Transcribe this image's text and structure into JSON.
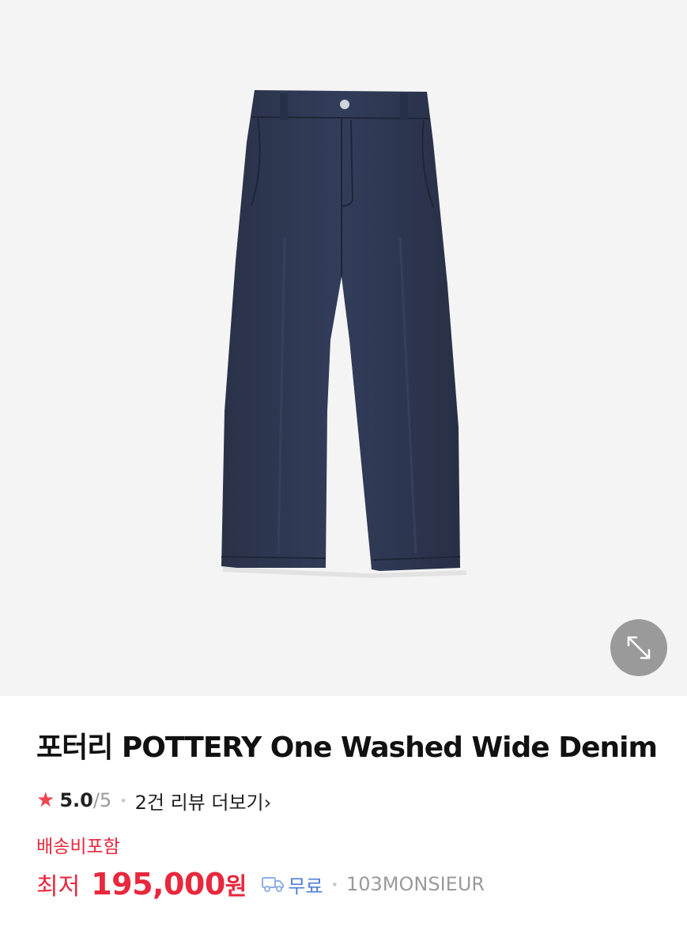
{
  "product": {
    "image_icon": "jeans-icon",
    "expand_icon": "expand-arrows-icon",
    "title": "포터리 POTTERY One Washed Wide Denim",
    "rating": {
      "star_icon": "star-icon",
      "score": "5.0",
      "max": "/5",
      "reviews": "2건 리뷰 더보기",
      "chevron": "›"
    },
    "shipping_included": "배송비포함",
    "price": {
      "prefix": "최저",
      "value": "195,000",
      "unit": "원"
    },
    "shipping": {
      "icon": "truck-icon",
      "label": "무료"
    },
    "seller": "103MONSIEUR"
  },
  "colors": {
    "accent_red": "#e8283c",
    "star": "#f0454c",
    "shipping_blue": "#4d7fd6",
    "denim": "#2b3550"
  }
}
